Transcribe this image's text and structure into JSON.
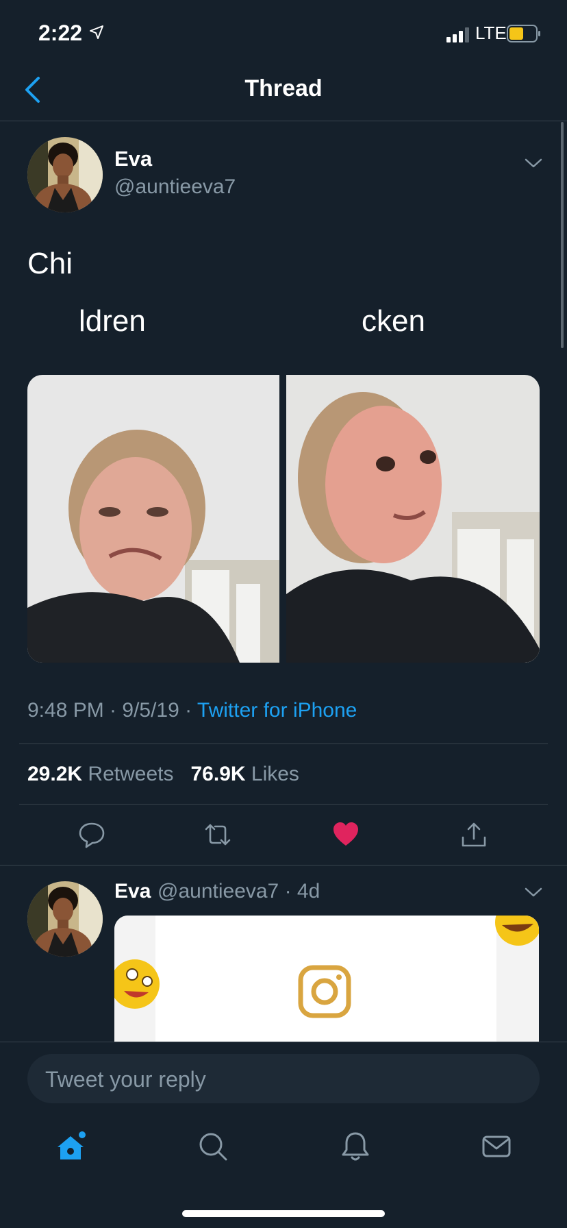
{
  "status_bar": {
    "time": "2:22",
    "network": "LTE"
  },
  "nav": {
    "title": "Thread",
    "back_icon": "chevron-left-icon"
  },
  "tweet": {
    "author_name": "Eva",
    "author_handle": "@auntieeva7",
    "text_line1": "Chi",
    "text_left": "ldren",
    "text_right": "cken",
    "timestamp": "9:48 PM · 9/5/19 · ",
    "source": "Twitter for iPhone",
    "retweets_count": "29.2K",
    "retweets_label": "Retweets",
    "likes_count": "76.9K",
    "likes_label": "Likes",
    "liked": true
  },
  "reply_tweet": {
    "author_name": "Eva",
    "author_handle": "@auntieeva7",
    "age": "· 4d"
  },
  "reply_bar": {
    "placeholder": "Tweet your reply"
  },
  "tab_bar": {
    "items": [
      "home-icon",
      "search-icon",
      "notifications-icon",
      "messages-icon"
    ],
    "active": "home-icon"
  },
  "colors": {
    "background": "#15202b",
    "accent": "#1da1f2",
    "like": "#e0245e",
    "secondary_text": "#8899a6",
    "divider": "#38444d"
  }
}
